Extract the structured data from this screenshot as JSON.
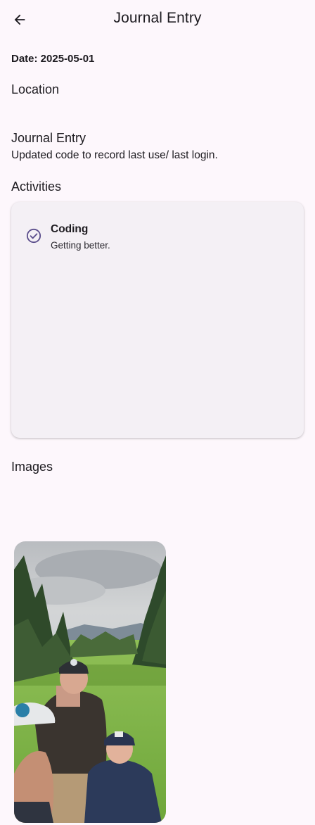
{
  "app_bar": {
    "title": "Journal Entry",
    "back_icon": "arrow-left-icon"
  },
  "entry": {
    "date_line": "Date: 2025-05-01",
    "location_heading": "Location",
    "journal_heading": "Journal Entry",
    "journal_text": "Updated code to record last use/ last login.",
    "activities_heading": "Activities",
    "activities": [
      {
        "icon": "check-circle-icon",
        "name": "Coding",
        "description": "Getting better."
      }
    ],
    "images_heading": "Images"
  },
  "colors": {
    "background": "#fdf7fc",
    "card": "#f4f0f5",
    "accent": "#5b4e8c"
  }
}
